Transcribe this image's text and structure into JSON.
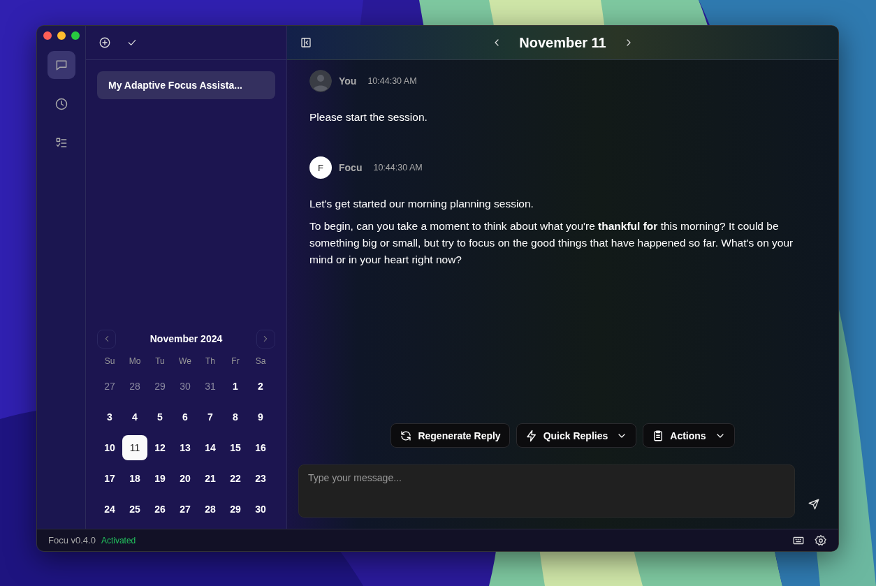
{
  "sidebar": {
    "items": [
      {
        "kind": "chat",
        "selected": true
      },
      {
        "kind": "history",
        "selected": false
      },
      {
        "kind": "tasks",
        "selected": false
      }
    ]
  },
  "chat_list": {
    "items": [
      {
        "title": "My Adaptive Focus Assista...",
        "selected": true
      }
    ]
  },
  "calendar": {
    "title": "November 2024",
    "weekdays": [
      "Su",
      "Mo",
      "Tu",
      "We",
      "Th",
      "Fr",
      "Sa"
    ],
    "days": [
      {
        "label": "27",
        "muted": true,
        "selected": false
      },
      {
        "label": "28",
        "muted": true,
        "selected": false
      },
      {
        "label": "29",
        "muted": true,
        "selected": false
      },
      {
        "label": "30",
        "muted": true,
        "selected": false
      },
      {
        "label": "31",
        "muted": true,
        "selected": false
      },
      {
        "label": "1",
        "muted": false,
        "selected": false
      },
      {
        "label": "2",
        "muted": false,
        "selected": false
      },
      {
        "label": "3",
        "muted": false,
        "selected": false
      },
      {
        "label": "4",
        "muted": false,
        "selected": false
      },
      {
        "label": "5",
        "muted": false,
        "selected": false
      },
      {
        "label": "6",
        "muted": false,
        "selected": false
      },
      {
        "label": "7",
        "muted": false,
        "selected": false
      },
      {
        "label": "8",
        "muted": false,
        "selected": false
      },
      {
        "label": "9",
        "muted": false,
        "selected": false
      },
      {
        "label": "10",
        "muted": false,
        "selected": false
      },
      {
        "label": "11",
        "muted": false,
        "selected": true
      },
      {
        "label": "12",
        "muted": false,
        "selected": false
      },
      {
        "label": "13",
        "muted": false,
        "selected": false
      },
      {
        "label": "14",
        "muted": false,
        "selected": false
      },
      {
        "label": "15",
        "muted": false,
        "selected": false
      },
      {
        "label": "16",
        "muted": false,
        "selected": false
      },
      {
        "label": "17",
        "muted": false,
        "selected": false
      },
      {
        "label": "18",
        "muted": false,
        "selected": false
      },
      {
        "label": "19",
        "muted": false,
        "selected": false
      },
      {
        "label": "20",
        "muted": false,
        "selected": false
      },
      {
        "label": "21",
        "muted": false,
        "selected": false
      },
      {
        "label": "22",
        "muted": false,
        "selected": false
      },
      {
        "label": "23",
        "muted": false,
        "selected": false
      },
      {
        "label": "24",
        "muted": false,
        "selected": false
      },
      {
        "label": "25",
        "muted": false,
        "selected": false
      },
      {
        "label": "26",
        "muted": false,
        "selected": false
      },
      {
        "label": "27",
        "muted": false,
        "selected": false
      },
      {
        "label": "28",
        "muted": false,
        "selected": false
      },
      {
        "label": "29",
        "muted": false,
        "selected": false
      },
      {
        "label": "30",
        "muted": false,
        "selected": false
      }
    ]
  },
  "header": {
    "title": "November 11"
  },
  "messages": [
    {
      "kind": "user",
      "author": "You",
      "time": "10:44:30 AM",
      "paragraphs": [
        "Please start the session."
      ]
    },
    {
      "kind": "assistant",
      "author": "Focu",
      "avatar": "F",
      "time": "10:44:30 AM",
      "paragraphs": [
        "Let's get started our morning planning session.",
        "To begin, can you take a moment to think about what you're **thankful for** this morning? It could be something big or small, but try to focus on the good things that have happened so far. What's on your mind or in your heart right now?"
      ]
    }
  ],
  "actions": [
    {
      "kind": "regenerate",
      "label": "Regenerate Reply",
      "dropdown": false
    },
    {
      "kind": "quick",
      "label": "Quick Replies",
      "dropdown": true
    },
    {
      "kind": "clipboard",
      "label": "Actions",
      "dropdown": true
    }
  ],
  "composer": {
    "placeholder": "Type your message..."
  },
  "status_bar": {
    "version": "Focu v0.4.0",
    "status": "Activated"
  }
}
